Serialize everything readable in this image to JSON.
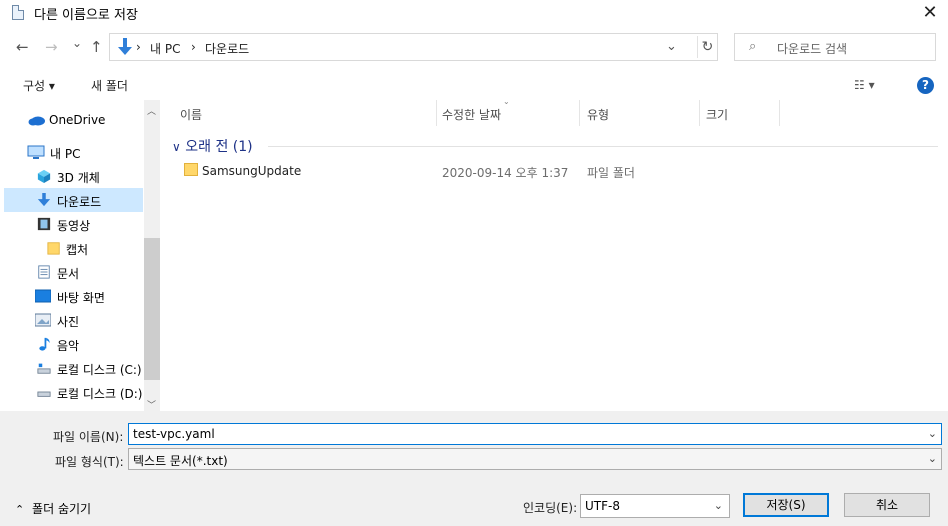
{
  "window": {
    "title": "다른 이름으로 저장",
    "close": "✕"
  },
  "nav": {
    "back": "←",
    "forward": "→",
    "recent": "⌄",
    "up": "↑",
    "breadcrumb": [
      "내 PC",
      "다운로드"
    ],
    "sep": "›",
    "refresh": "↻",
    "dropdown": "⌄"
  },
  "search": {
    "placeholder": "다운로드 검색"
  },
  "toolbar": {
    "organize": "구성 ▾",
    "new_folder": "새 폴더",
    "view": "☷ ▾",
    "help": "?"
  },
  "sidebar": {
    "items": [
      {
        "label": "OneDrive"
      },
      {
        "label": "내 PC"
      },
      {
        "label": "3D 개체"
      },
      {
        "label": "다운로드"
      },
      {
        "label": "동영상"
      },
      {
        "label": "캡처"
      },
      {
        "label": "문서"
      },
      {
        "label": "바탕 화면"
      },
      {
        "label": "사진"
      },
      {
        "label": "음악"
      },
      {
        "label": "로컬 디스크 (C:)"
      },
      {
        "label": "로컬 디스크 (D:)"
      }
    ],
    "scroll_up": "︿",
    "scroll_down": "﹀"
  },
  "columns": {
    "name": "이름",
    "date": "수정한 날짜",
    "type": "유형",
    "size": "크기"
  },
  "group": {
    "label": "오래 전 (1)"
  },
  "files": [
    {
      "name": "SamsungUpdate",
      "date": "2020-09-14 오후 1:37",
      "type": "파일 폴더"
    }
  ],
  "form": {
    "filename_label": "파일 이름(N):",
    "filename_value": "test-vpc.yaml",
    "filetype_label": "파일 형식(T):",
    "filetype_value": "텍스트 문서(*.txt)",
    "dd": "⌄"
  },
  "footer": {
    "hide_folders": "폴더 숨기기",
    "encoding_label": "인코딩(E):",
    "encoding_value": "UTF-8",
    "save": "저장(S)",
    "cancel": "취소"
  },
  "colors": {
    "accent": "#0078d7",
    "selected": "#cde8ff",
    "help": "#1665c0",
    "group": "#1e3287"
  }
}
